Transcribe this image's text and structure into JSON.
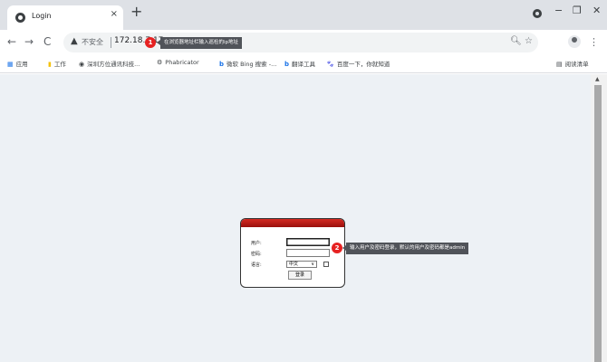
{
  "browser": {
    "tab_title": "Login",
    "tab_close": "×",
    "new_tab": "+",
    "window_minimize": "−",
    "window_restore": "❐",
    "window_close": "✕"
  },
  "toolbar": {
    "back": "←",
    "forward": "→",
    "reload": "C",
    "security_label": "不安全",
    "url": "172.18.7.17",
    "menu": "⋮"
  },
  "annotations": [
    {
      "number": "1",
      "text": "在浏览器地址栏输入巡检的ip地址"
    },
    {
      "number": "2",
      "text": "输入用户及密码登录，默认的用户及密码都是admin"
    }
  ],
  "bookmarks": {
    "items": [
      {
        "icon": "apps-icon",
        "label": "应用"
      },
      {
        "icon": "folder-icon",
        "label": "工作"
      },
      {
        "icon": "globe-icon",
        "label": "深圳方位通讯科技..."
      },
      {
        "icon": "phabricator-icon",
        "label": "Phabricator"
      },
      {
        "icon": "bing-icon",
        "label": "微软 Bing 搜索 -..."
      },
      {
        "icon": "bing-icon",
        "label": "翻译工具"
      },
      {
        "icon": "baidu-icon",
        "label": "百度一下，你就知道"
      }
    ],
    "reading_list": "阅读清单"
  },
  "login": {
    "user_label": "用户:",
    "password_label": "密码:",
    "language_label": "语言:",
    "language_selected": "中文",
    "login_button": "登录"
  },
  "colors": {
    "tab_strip": "#dee1e6",
    "page_background": "#edf1f5",
    "login_header": "#c8201b",
    "annotation_badge": "#e62222",
    "tooltip": "#505359"
  }
}
